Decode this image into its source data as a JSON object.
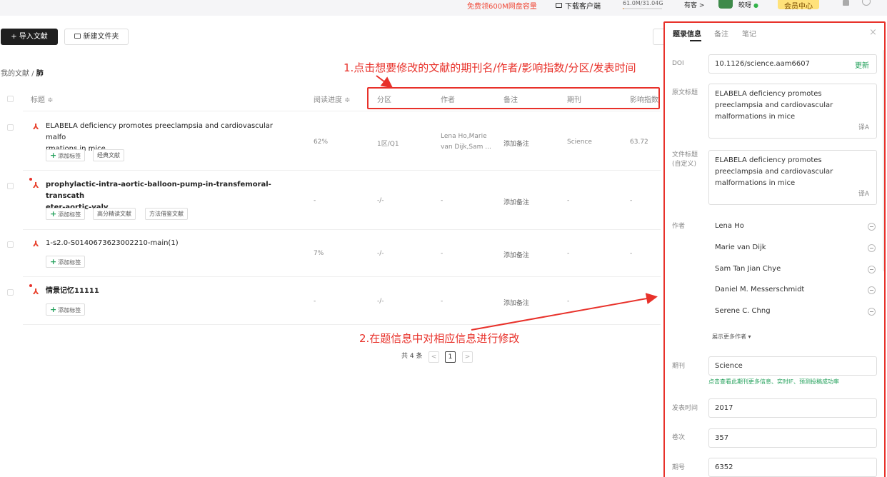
{
  "topbar": {
    "promo": "免费领600M网盘容量",
    "download": "下载客户端",
    "storage": "61.0M/31.04G",
    "storage_fraction": 0.002,
    "extra": "有客 >",
    "user": "皎呀",
    "vip": "会员中心"
  },
  "toolbar": {
    "import": "+ 导入文献",
    "new_folder": "新建文件夹"
  },
  "breadcrumb": {
    "root": "我的文献",
    "sep": " / ",
    "current": "肺"
  },
  "annotations": {
    "step1": "1.点击想要修改的文献的期刊名/作者/影响指数/分区/发表时间",
    "step2": "2.在题信息中对相应信息进行修改"
  },
  "table": {
    "headers": {
      "title": "标题 ≑",
      "progress": "阅读进度 ≑",
      "zone": "分区",
      "author": "作者",
      "note": "备注",
      "journal": "期刊",
      "impact": "影响指数"
    },
    "rows": [
      {
        "title_l1": "ELABELA deficiency promotes preeclampsia and cardiovascular malfo",
        "title_l2": "rmations in mice",
        "add_tag": "添加标签",
        "tags": [
          "经典文献"
        ],
        "progress": "62%",
        "zone": "1区/Q1",
        "author_l1": "Lena Ho,Marie",
        "author_l2": "van Dijk,Sam ...",
        "note": "添加备注",
        "journal": "Science",
        "impact": "63.72"
      },
      {
        "title_l1": "prophylactic-intra-aortic-balloon-pump-in-transfemoral-transcath",
        "title_l2": "eter-aortic-valv",
        "add_tag": "添加标签",
        "tags": [
          "高分精读文献",
          "方法借鉴文献"
        ],
        "progress": "-",
        "zone": "-/-",
        "author": "-",
        "note": "添加备注",
        "journal": "-",
        "impact": "-"
      },
      {
        "title_l1": "1-s2.0-S0140673623002210-main(1)",
        "add_tag": "添加标签",
        "progress": "7%",
        "zone": "-/-",
        "author": "-",
        "note": "添加备注",
        "journal": "-",
        "impact": "-"
      },
      {
        "title_l1": "情景记忆11111",
        "add_tag": "添加标签",
        "progress": "-",
        "zone": "-/-",
        "author": "-",
        "note": "添加备注",
        "journal": "-"
      }
    ]
  },
  "pager": {
    "total": "共 4 条",
    "prev": "<",
    "page": "1",
    "next": ">"
  },
  "panel": {
    "tabs": [
      "题录信息",
      "备注",
      "笔记"
    ],
    "close": "×",
    "doi_label": "DOI",
    "doi": "10.1126/science.aam6607",
    "refresh": "更新",
    "orig_title_label": "原文标题",
    "orig_title": "ELABELA deficiency promotes preeclampsia and cardiovascular malformations in mice",
    "file_title_label_l1": "文件标题",
    "file_title_label_l2": "(自定义)",
    "file_title": "ELABELA deficiency promotes preeclampsia and cardiovascular malformations in mice",
    "translate_icon": "译A",
    "authors_label": "作者",
    "authors": [
      "Lena Ho",
      "Marie van Dijk",
      "Sam Tan Jian Chye",
      "Daniel M. Messerschmidt",
      "Serene C. Chng"
    ],
    "more_authors": "展示更多作者 ▾",
    "journal_label": "期刊",
    "journal": "Science",
    "journal_hint": "点击查看此期刊更多信息、实时IF、预测投稿成功率",
    "pubdate_label": "发表时间",
    "pubdate": "2017",
    "volume_label": "卷次",
    "volume": "357",
    "issue_label": "期号",
    "issue": "6352"
  },
  "colors": {
    "annotation": "#e8312a",
    "accent_green": "#22a05a",
    "pdf_red": "#e8412c"
  }
}
